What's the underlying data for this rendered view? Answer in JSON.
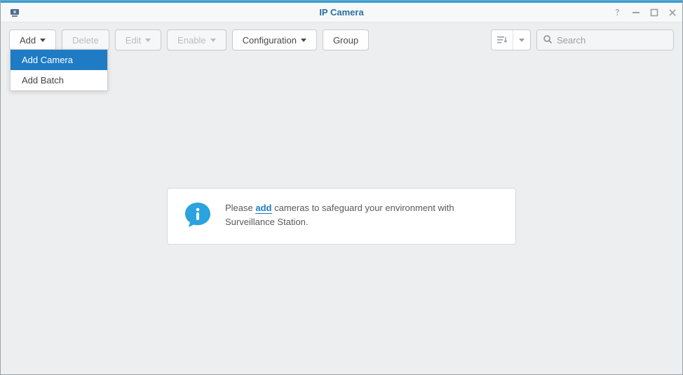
{
  "window": {
    "title": "IP Camera"
  },
  "toolbar": {
    "add_label": "Add",
    "delete_label": "Delete",
    "edit_label": "Edit",
    "enable_label": "Enable",
    "configuration_label": "Configuration",
    "group_label": "Group"
  },
  "search": {
    "placeholder": "Search",
    "value": ""
  },
  "add_menu": {
    "items": [
      {
        "label": "Add Camera",
        "active": true
      },
      {
        "label": "Add Batch",
        "active": false
      }
    ]
  },
  "empty": {
    "prefix": "Please ",
    "link": "add",
    "suffix1": " cameras to safeguard your environment with",
    "line2": "Surveillance Station."
  }
}
